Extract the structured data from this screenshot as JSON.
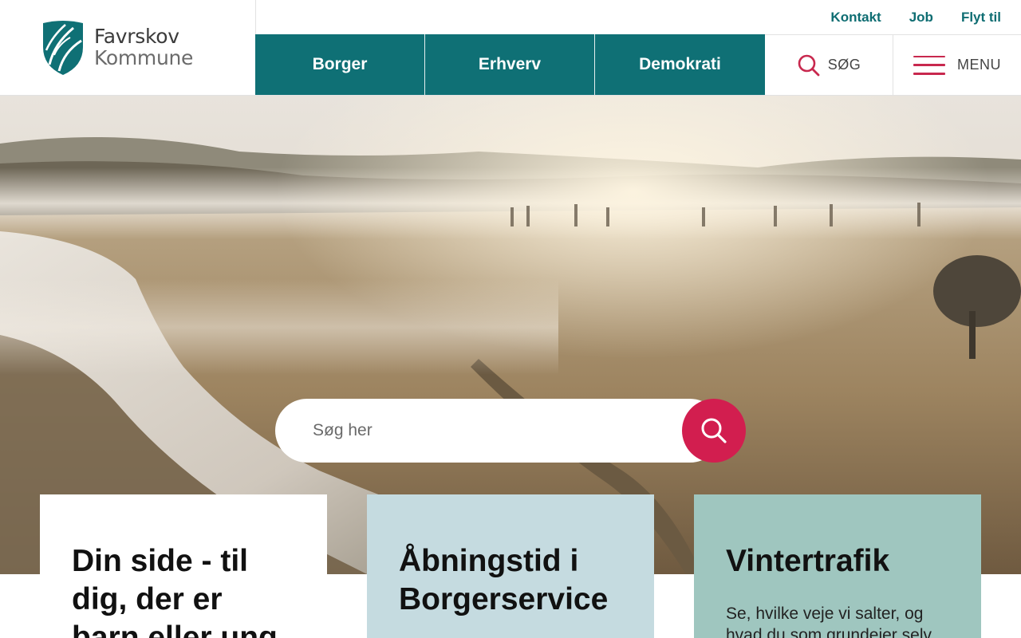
{
  "logo": {
    "line1": "Favrskov",
    "line2": "Kommune",
    "icon": "favrskov-leaf-shield-logo",
    "color": "#0f7075"
  },
  "top_links": [
    "Kontakt",
    "Job",
    "Flyt til"
  ],
  "main_nav": [
    "Borger",
    "Erhverv",
    "Demokrati"
  ],
  "search_toggle": {
    "label": "SØG",
    "icon": "search-icon"
  },
  "menu_toggle": {
    "label": "MENU",
    "icon": "hamburger-icon"
  },
  "hero": {
    "image": "misty-river-valley-sunrise-photo",
    "search_placeholder": "Søg her",
    "search_button_icon": "search-icon"
  },
  "cards": [
    {
      "title": "Din side - til dig, der er barn eller ung",
      "text": ""
    },
    {
      "title": "Åbningstid i Borgerservice",
      "text": ""
    },
    {
      "title": "Vintertrafik",
      "text": "Se, hvilke veje vi salter, og hvad du som grundejer selv"
    }
  ],
  "colors": {
    "primary": "#0f7075",
    "accent": "#d21e4f",
    "card2": "#c5dbe0",
    "card3": "#9fc6bf"
  }
}
